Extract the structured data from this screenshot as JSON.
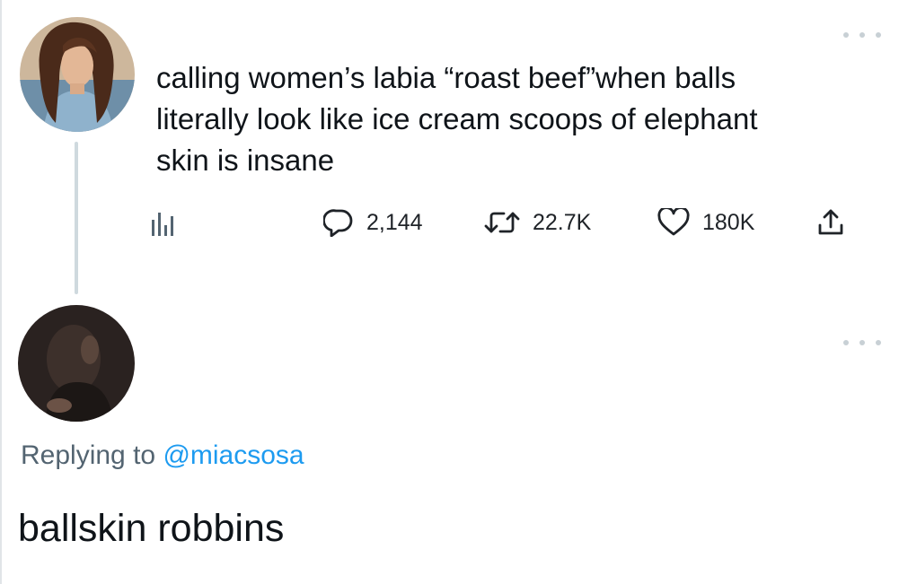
{
  "tweet": {
    "text": "calling women’s labia “roast beef”when balls\nliterally look like ice cream scoops of elephant\nskin is insane",
    "stats": {
      "replies": "2,144",
      "retweets": "22.7K",
      "likes": "180K"
    },
    "icons": {
      "views": "analytics-icon",
      "reply": "reply-icon",
      "retweet": "retweet-icon",
      "like": "heart-icon",
      "share": "share-icon",
      "more": "more-dots-icon"
    }
  },
  "reply": {
    "replying_prefix": "Replying to",
    "replying_handle": "@miacsosa",
    "text": "ballskin robbins"
  },
  "colors": {
    "text": "#0f1419",
    "secondary": "#536471",
    "link": "#1d9bf0",
    "thread_line": "#cfd9de"
  }
}
